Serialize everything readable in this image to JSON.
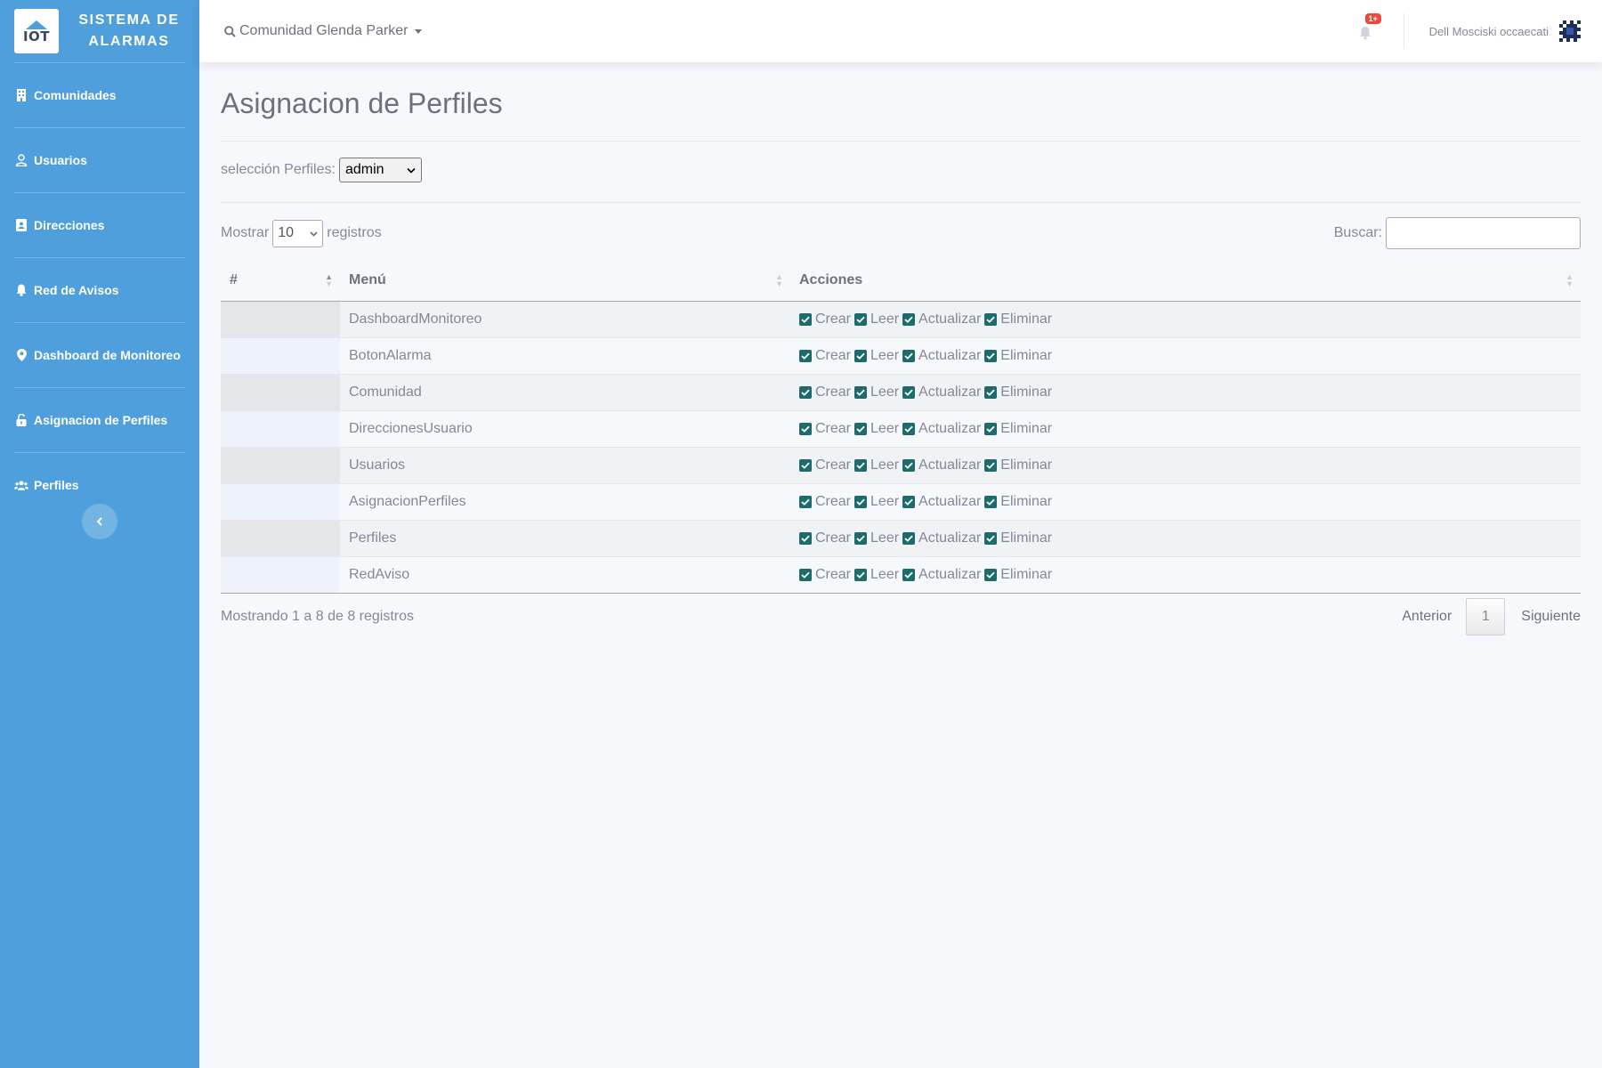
{
  "brand": {
    "logo_text": "IOT",
    "title": "SISTEMA DE ALARMAS"
  },
  "sidebar": {
    "items": [
      {
        "label": "Comunidades",
        "icon": "building-icon"
      },
      {
        "label": "Usuarios",
        "icon": "user-icon"
      },
      {
        "label": "Direcciones",
        "icon": "address-card-icon"
      },
      {
        "label": "Red de Avisos",
        "icon": "bell-icon"
      },
      {
        "label": "Dashboard de Monitoreo",
        "icon": "map-marker-icon"
      },
      {
        "label": "Asignacion de Perfiles",
        "icon": "lock-open-icon"
      },
      {
        "label": "Perfiles",
        "icon": "users-icon"
      }
    ],
    "toggle_icon": "chevron-left-icon"
  },
  "topbar": {
    "community": "Comunidad Glenda Parker",
    "alerts_badge": "1+",
    "user_name": "Dell Mosciski occaecati"
  },
  "page": {
    "title": "Asignacion de Perfiles",
    "profile_label": "selección Perfiles:",
    "profile_selected": "admin"
  },
  "datatable": {
    "show_label": "Mostrar",
    "page_length": "10",
    "records_label": "registros",
    "search_label": "Buscar:",
    "search_value": "",
    "columns": [
      "#",
      "Menú",
      "Acciones"
    ],
    "action_labels": [
      "Crear",
      "Leer",
      "Actualizar",
      "Eliminar"
    ],
    "rows": [
      {
        "num": "",
        "menu": "DashboardMonitoreo"
      },
      {
        "num": "",
        "menu": "BotonAlarma"
      },
      {
        "num": "",
        "menu": "Comunidad"
      },
      {
        "num": "",
        "menu": "DireccionesUsuario"
      },
      {
        "num": "",
        "menu": "Usuarios"
      },
      {
        "num": "",
        "menu": "AsignacionPerfiles"
      },
      {
        "num": "",
        "menu": "Perfiles"
      },
      {
        "num": "",
        "menu": "RedAviso"
      }
    ],
    "info": "Mostrando 1 a 8 de 8 registros",
    "pagination": {
      "prev": "Anterior",
      "current": "1",
      "next": "Siguiente"
    }
  },
  "colors": {
    "sidebar": "#4e9fdb",
    "checkbox": "#1e6b6b",
    "badge": "#e74a3b"
  }
}
